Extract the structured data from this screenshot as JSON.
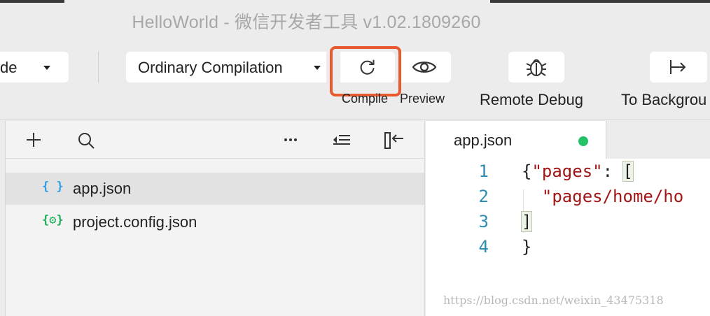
{
  "window": {
    "title": "HelloWorld - 微信开发者工具 v1.02.1809260"
  },
  "toolbar": {
    "mode_select": {
      "label": "de"
    },
    "compile_select": {
      "label": "Ordinary Compilation"
    },
    "compile": {
      "label": "Compile"
    },
    "preview": {
      "label": "Preview"
    },
    "remote_debug": {
      "label": "Remote Debug"
    },
    "to_background": {
      "label": "To Backgrou"
    },
    "highlight_color": "#e8592f"
  },
  "explorer": {
    "toolbar_icons": [
      "add-icon",
      "search-icon",
      "more-icon",
      "collapse-icon",
      "hide-panel-icon"
    ],
    "files": [
      {
        "icon": "{ }",
        "icon_color": "#2f9fe6",
        "name": "app.json",
        "selected": true
      },
      {
        "icon": "{⚙}",
        "icon_color": "#1fae5a",
        "name": "project.config.json",
        "selected": false
      }
    ]
  },
  "editor": {
    "tab": {
      "label": "app.json",
      "modified_dot_color": "#23c267"
    },
    "lines": [
      {
        "no": "1",
        "parts": [
          "{",
          "\"pages\"",
          ": ",
          "["
        ]
      },
      {
        "no": "2",
        "parts": [
          "  ",
          "\"pages/home/ho"
        ]
      },
      {
        "no": "3",
        "parts": [
          "]"
        ]
      },
      {
        "no": "4",
        "parts": [
          "}"
        ]
      }
    ]
  },
  "watermark": "https://blog.csdn.net/weixin_43475318"
}
